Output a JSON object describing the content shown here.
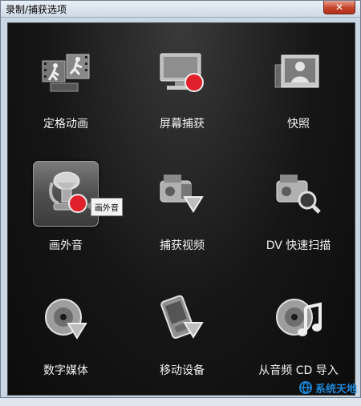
{
  "window": {
    "title": "录制/捕获选项",
    "close_glyph": "✕"
  },
  "tiles": [
    {
      "label": "定格动画",
      "icon": "stop-motion-icon"
    },
    {
      "label": "屏幕捕获",
      "icon": "screen-capture-icon"
    },
    {
      "label": "快照",
      "icon": "snapshot-icon"
    },
    {
      "label": "画外音",
      "icon": "voice-over-microphone-icon",
      "active": true
    },
    {
      "label": "捕获视频",
      "icon": "capture-video-icon"
    },
    {
      "label": "DV 快速扫描",
      "icon": "dv-quick-scan-icon"
    },
    {
      "label": "数字媒体",
      "icon": "digital-media-icon"
    },
    {
      "label": "移动设备",
      "icon": "mobile-device-icon"
    },
    {
      "label": "从音频 CD 导入",
      "icon": "audio-cd-import-icon"
    }
  ],
  "tooltip": {
    "text": "画外音"
  },
  "watermark": {
    "text": "系统天地"
  },
  "colors": {
    "record_red": "#e0202a",
    "watermark_blue": "#1c87d8"
  }
}
